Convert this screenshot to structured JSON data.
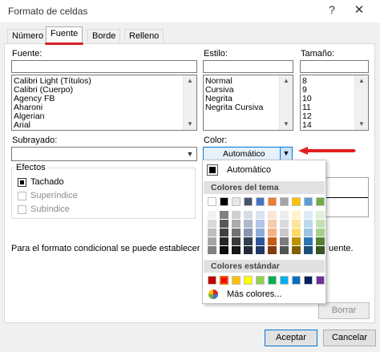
{
  "window": {
    "title": "Formato de celdas",
    "help": "?",
    "close": "✕"
  },
  "tabs": [
    "Número",
    "Fuente",
    "Borde",
    "Relleno"
  ],
  "font": {
    "label": "Fuente:",
    "value": "",
    "items": [
      "Calibri Light (Títulos)",
      "Calibri (Cuerpo)",
      "Agency FB",
      "Aharoni",
      "Algerian",
      "Arial"
    ]
  },
  "style": {
    "label": "Estilo:",
    "value": "",
    "items": [
      "Normal",
      "Cursiva",
      "Negrita",
      "Negrita Cursiva"
    ]
  },
  "size": {
    "label": "Tamaño:",
    "value": "",
    "items": [
      "8",
      "9",
      "10",
      "11",
      "12",
      "14"
    ]
  },
  "underline": {
    "label": "Subrayado:",
    "value": ""
  },
  "color": {
    "label": "Color:",
    "value": "Automático"
  },
  "effects": {
    "title": "Efectos",
    "items": [
      {
        "label": "Tachado",
        "checked": true,
        "enabled": true
      },
      {
        "label": "Superíndice",
        "checked": false,
        "enabled": false
      },
      {
        "label": "Subíndice",
        "checked": false,
        "enabled": false
      }
    ]
  },
  "info_text_left": "Para el formato condicional se puede establecer estil",
  "info_text_right": "uente.",
  "buttons": {
    "clear": "Borrar",
    "accept": "Aceptar",
    "cancel": "Cancelar"
  },
  "color_popup": {
    "automatic": "Automático",
    "theme_header": "Colores del tema",
    "standard_header": "Colores estándar",
    "more": "Más colores...",
    "theme_colors": [
      "#ffffff",
      "#000000",
      "#e7e6e6",
      "#44546a",
      "#4472c4",
      "#ed7d31",
      "#a5a5a5",
      "#ffc000",
      "#5b9bd5",
      "#70ad47"
    ],
    "theme_shades": [
      [
        "#f2f2f2",
        "#d9d9d9",
        "#bfbfbf",
        "#a6a6a6",
        "#808080"
      ],
      [
        "#808080",
        "#595959",
        "#404040",
        "#262626",
        "#0d0d0d"
      ],
      [
        "#d0cece",
        "#aeaaaa",
        "#757171",
        "#3a3838",
        "#171616"
      ],
      [
        "#d6dce4",
        "#adb9ca",
        "#8496b0",
        "#333f4f",
        "#222a35"
      ],
      [
        "#d9e2f3",
        "#b4c6e7",
        "#8eaadb",
        "#2f5496",
        "#1f3864"
      ],
      [
        "#fbe5d5",
        "#f7cbac",
        "#f4b183",
        "#c55a11",
        "#833c0b"
      ],
      [
        "#ededed",
        "#dbdbdb",
        "#c9c9c9",
        "#7b7b7b",
        "#525252"
      ],
      [
        "#fff2cc",
        "#fee599",
        "#ffd965",
        "#bf9000",
        "#7f6000"
      ],
      [
        "#deebf6",
        "#bdd7ee",
        "#9dc3e6",
        "#2e75b5",
        "#1e4e79"
      ],
      [
        "#e2efd9",
        "#c5e0b3",
        "#a8d08d",
        "#538135",
        "#375623"
      ]
    ],
    "standard_colors": [
      "#c00000",
      "#ff0000",
      "#ffc000",
      "#ffff00",
      "#92d050",
      "#00b050",
      "#00b0f0",
      "#0070c0",
      "#002060",
      "#7030a0"
    ],
    "selected_standard_index": 1
  },
  "annotation_color": "#e02020"
}
